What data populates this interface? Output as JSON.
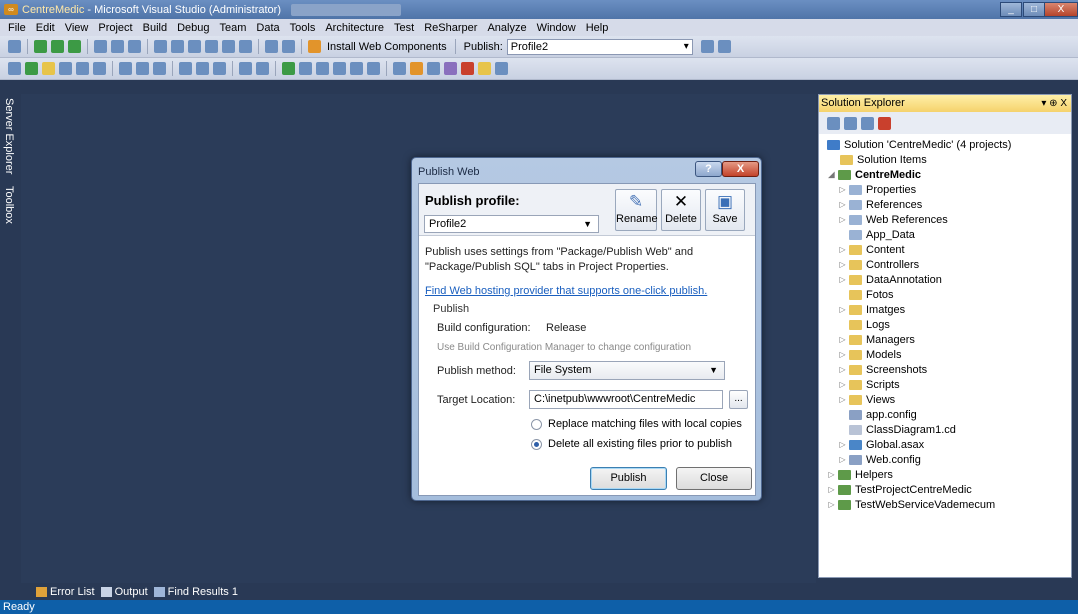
{
  "window": {
    "app_title": "CentreMedic",
    "title_rest": " - Microsoft Visual Studio (Administrator)",
    "controls": [
      "_",
      "□",
      "X"
    ]
  },
  "menu": [
    "File",
    "Edit",
    "View",
    "Project",
    "Build",
    "Debug",
    "Team",
    "Data",
    "Tools",
    "Architecture",
    "Test",
    "ReSharper",
    "Analyze",
    "Window",
    "Help"
  ],
  "toolbar": {
    "install_label": "Install Web Components",
    "publish_label": "Publish:",
    "publish_value": "Profile2"
  },
  "side_tabs": {
    "server_explorer": "Server Explorer",
    "toolbox": "Toolbox"
  },
  "dialog": {
    "title": "Publish Web",
    "help": "?",
    "close": "X",
    "profile_label": "Publish profile:",
    "profile_value": "Profile2",
    "rename": "Rename",
    "delete": "Delete",
    "save": "Save",
    "description": "Publish uses settings from \"Package/Publish Web\" and \"Package/Publish SQL\" tabs in Project Properties.",
    "link": "Find Web hosting provider that supports one-click publish.",
    "section": "Publish",
    "build_config_label": "Build configuration:",
    "build_config_value": "Release",
    "build_hint": "Use Build Configuration Manager to change configuration",
    "method_label": "Publish method:",
    "method_value": "File System",
    "target_label": "Target Location:",
    "target_value": "C:\\inetpub\\wwwroot\\CentreMedic",
    "browse": "...",
    "radio_replace": "Replace matching files with local copies",
    "radio_delete": "Delete all existing files prior to publish",
    "selected_option": "delete",
    "publish_btn": "Publish",
    "close_btn": "Close"
  },
  "solution_explorer": {
    "title": "Solution Explorer",
    "pin": "▾ ⊕ X",
    "items": [
      {
        "label": "Solution 'CentreMedic' (4 projects)",
        "icon": "solution-icon"
      },
      {
        "label": "Solution Items",
        "icon": "folder-icon"
      },
      {
        "label": "CentreMedic",
        "icon": "project-icon"
      },
      {
        "label": "Properties",
        "icon": "properties-icon"
      },
      {
        "label": "References",
        "icon": "references-icon"
      },
      {
        "label": "Web References",
        "icon": "web-references-icon"
      },
      {
        "label": "App_Data",
        "icon": "folder-icon"
      },
      {
        "label": "Content",
        "icon": "folder-icon"
      },
      {
        "label": "Controllers",
        "icon": "folder-icon"
      },
      {
        "label": "DataAnnotation",
        "icon": "folder-icon"
      },
      {
        "label": "Fotos",
        "icon": "folder-icon"
      },
      {
        "label": "Imatges",
        "icon": "folder-icon"
      },
      {
        "label": "Logs",
        "icon": "folder-icon"
      },
      {
        "label": "Managers",
        "icon": "folder-icon"
      },
      {
        "label": "Models",
        "icon": "folder-icon"
      },
      {
        "label": "Screenshots",
        "icon": "folder-icon"
      },
      {
        "label": "Scripts",
        "icon": "folder-icon"
      },
      {
        "label": "Views",
        "icon": "folder-icon"
      },
      {
        "label": "app.config",
        "icon": "config-file-icon"
      },
      {
        "label": "ClassDiagram1.cd",
        "icon": "class-diagram-icon"
      },
      {
        "label": "Global.asax",
        "icon": "asax-file-icon"
      },
      {
        "label": "Web.config",
        "icon": "config-file-icon"
      },
      {
        "label": "Helpers",
        "icon": "project-icon"
      },
      {
        "label": "TestProjectCentreMedic",
        "icon": "project-icon"
      },
      {
        "label": "TestWebServiceVademecum",
        "icon": "project-icon"
      }
    ]
  },
  "bottom_tabs": [
    "Error List",
    "Output",
    "Find Results 1"
  ],
  "status": "Ready"
}
